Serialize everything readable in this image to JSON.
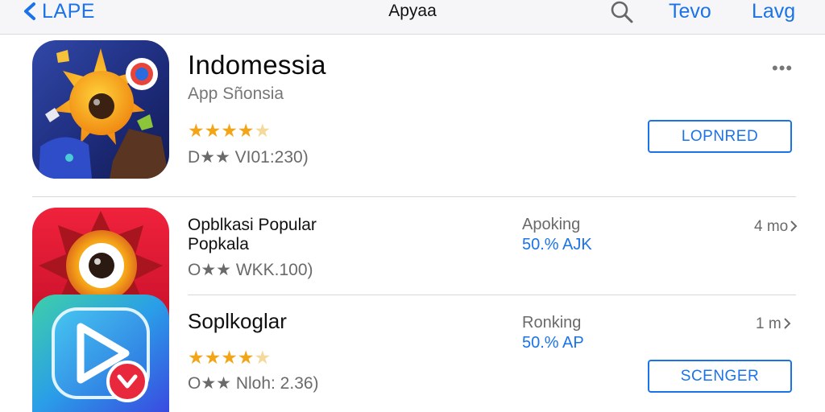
{
  "nav": {
    "back_label": "LAPE",
    "title": "Apyaa",
    "link1": "Tevo",
    "link2": "Lavg"
  },
  "featured": {
    "name": "Indomessia",
    "subtitle": "App Sñonsia",
    "rating": 4,
    "stars": [
      "★",
      "★",
      "★",
      "★",
      "★"
    ],
    "meta": "D★★ VI01:230)",
    "more": "•••",
    "button_label": "LOPNRED"
  },
  "list": [
    {
      "title_line1": "Opblkasi Popular",
      "title_line2": "Popkala",
      "meta": "O★★ WKK.100)",
      "rank_label": "Apoking",
      "rank_value": "50.% AJK",
      "size": "4 mo"
    },
    {
      "title": "Soplkoglar",
      "rating": 4,
      "stars": [
        "★",
        "★",
        "★",
        "★",
        "★"
      ],
      "meta": "O★★ Nloh: 2.36)",
      "rank_label": "Ronking",
      "rank_value": "50.% AP",
      "size": "1 m",
      "button_label": "SCENGER"
    }
  ],
  "colors": {
    "accent": "#1a73e8",
    "star": "#f2a516",
    "text_secondary": "#6a6a6a"
  }
}
